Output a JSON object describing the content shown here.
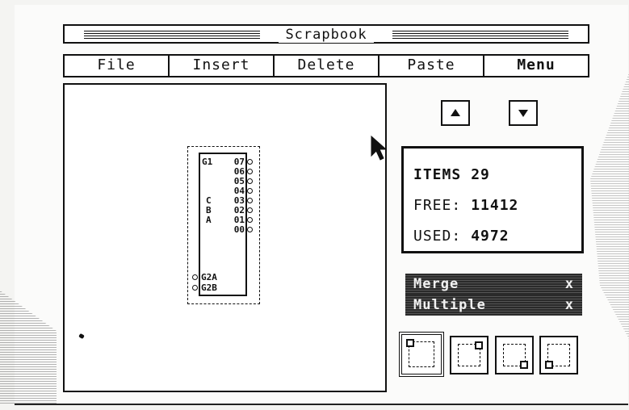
{
  "window": {
    "title": "Scrapbook"
  },
  "menu": [
    "File",
    "Insert",
    "Delete",
    "Paste",
    "Menu"
  ],
  "chip": {
    "top_left_pin": "G1",
    "left_pins": [
      "C",
      "B",
      "A"
    ],
    "bottom_pins": [
      "G2A",
      "G2B"
    ],
    "right_pins": [
      "07",
      "06",
      "05",
      "04",
      "03",
      "02",
      "01",
      "00"
    ]
  },
  "scroll": {
    "up_icon": "up-arrow-icon",
    "down_icon": "down-arrow-icon"
  },
  "stats": {
    "items_label": "ITEMS",
    "items_value": "29",
    "free_label": "FREE:",
    "free_value": "11412",
    "used_label": "USED:",
    "used_value": "4972"
  },
  "options": [
    {
      "label": "Merge",
      "mark": "x"
    },
    {
      "label": "Multiple",
      "mark": "x"
    }
  ],
  "anchor_buttons": [
    {
      "icon": "top-left-anchor-icon",
      "selected": true
    },
    {
      "icon": "top-right-anchor-icon",
      "selected": false
    },
    {
      "icon": "bottom-right-anchor-icon",
      "selected": false
    },
    {
      "icon": "bottom-left-anchor-icon",
      "selected": false
    }
  ]
}
